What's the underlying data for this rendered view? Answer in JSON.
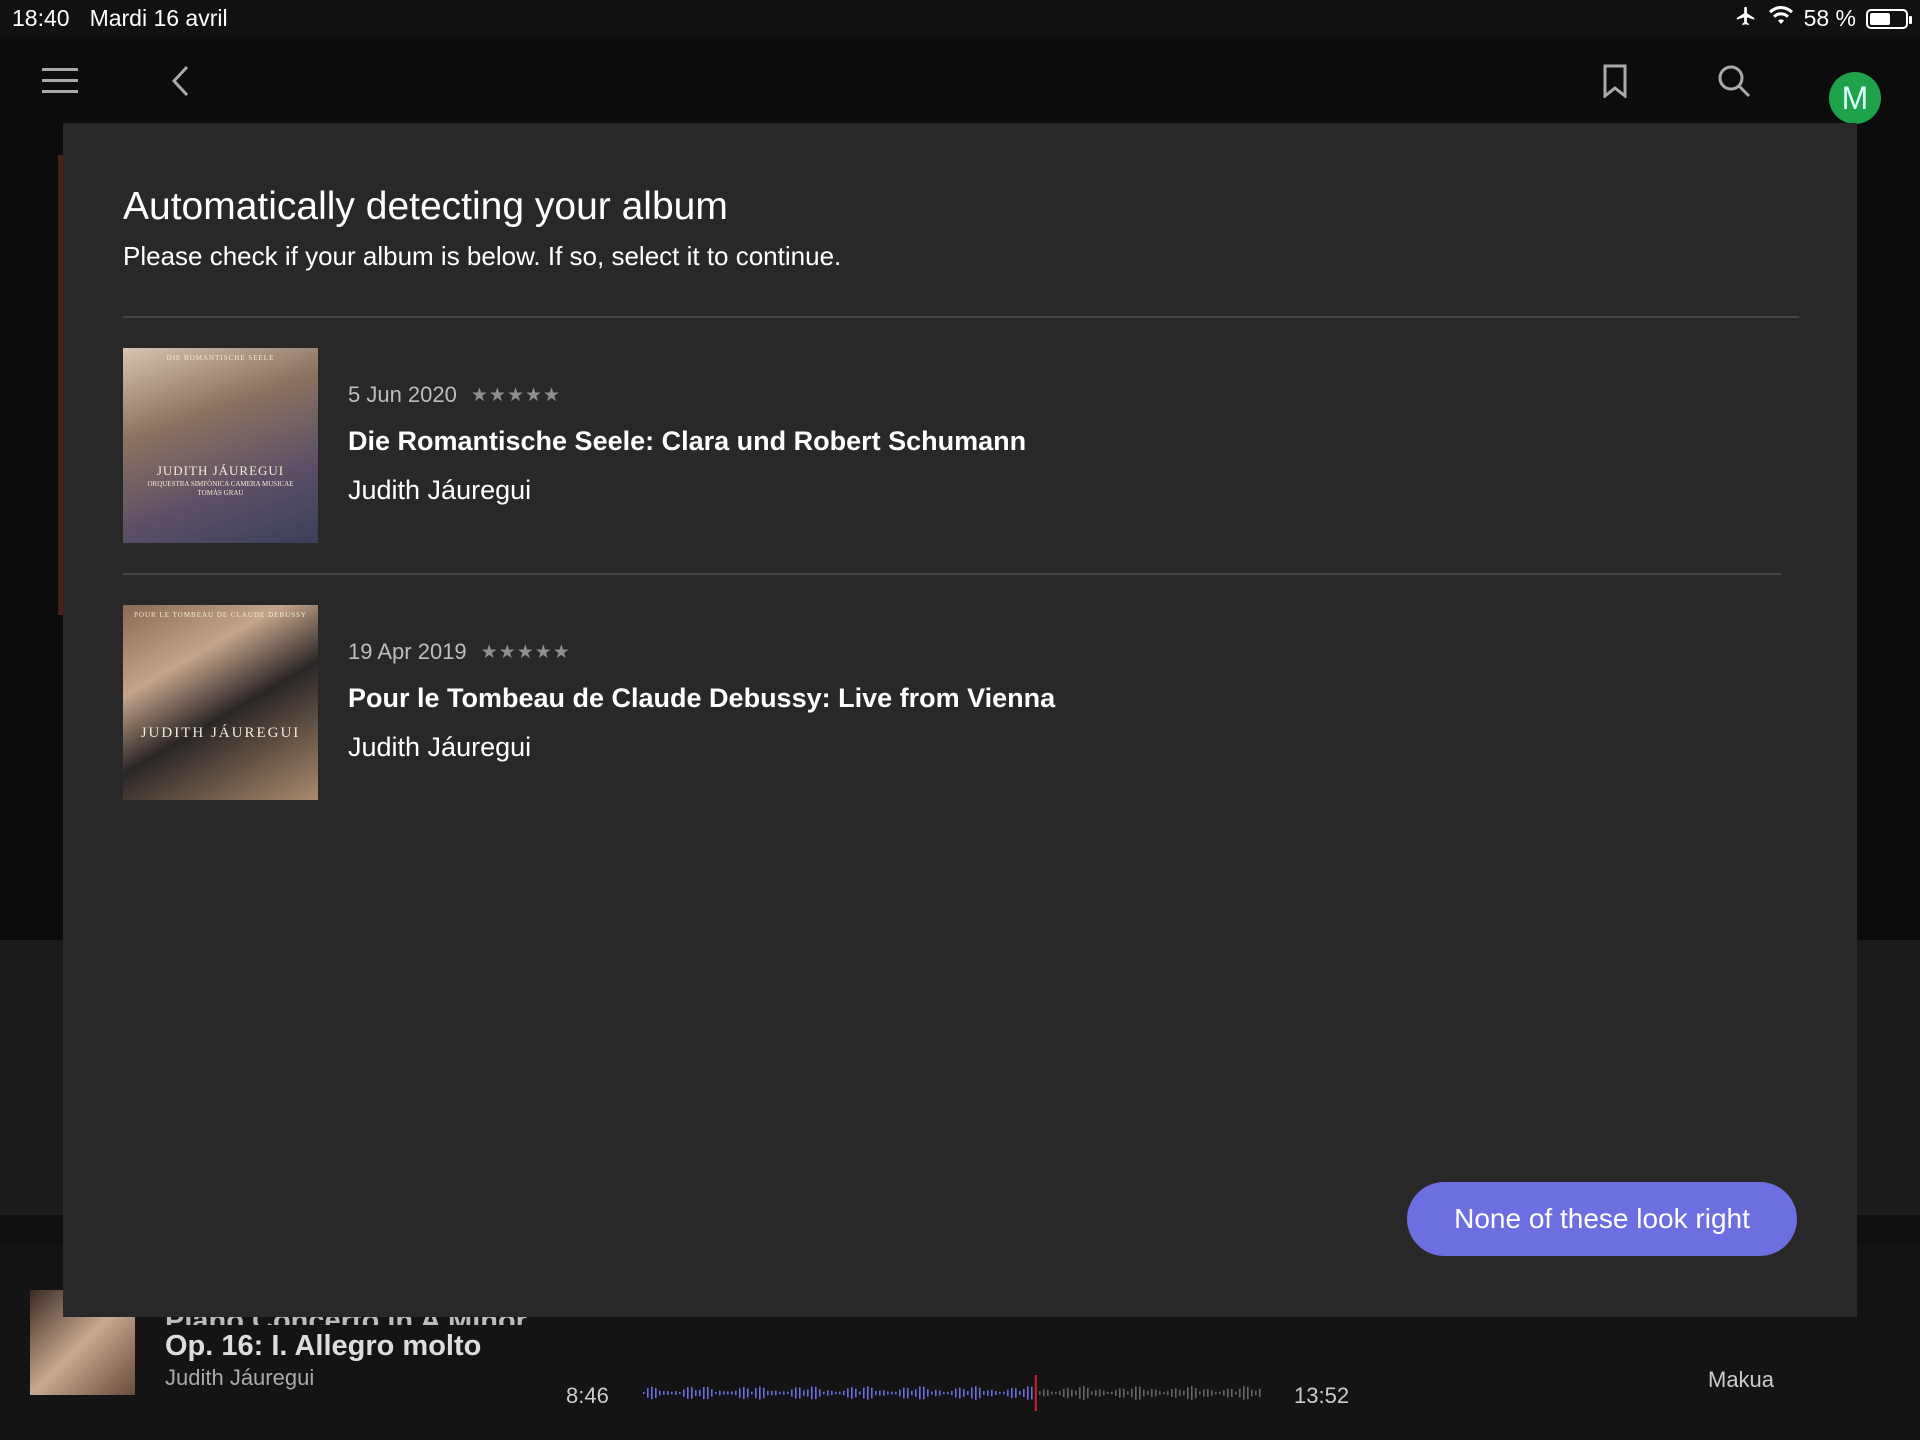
{
  "status_bar": {
    "time": "18:40",
    "date": "Mardi 16 avril",
    "battery": "58 %",
    "battery_level": 0.58
  },
  "nav": {
    "avatar_letter": "M",
    "avatar_color": "#1fa34a"
  },
  "modal": {
    "title": "Automatically detecting your album",
    "subtitle": "Please check if your album is below. If so, select it to continue.",
    "albums": [
      {
        "date": "5 Jun 2020",
        "stars": "★★★★★",
        "title": "Die Romantische Seele: Clara und Robert Schumann",
        "artist": "Judith Jáuregui",
        "art_lines": [
          "DIE ROMANTISCHE SEELE",
          "JUDITH JÁUREGUI",
          "ORQUESTRA SIMFÒNICA CAMERA MUSICAE",
          "TOMÀS GRAU"
        ]
      },
      {
        "date": "19 Apr 2019",
        "stars": "★★★★★",
        "title": "Pour le Tombeau de Claude Debussy: Live from Vienna",
        "artist": "Judith Jáuregui",
        "art_lines": [
          "POUR LE TOMBEAU DE CLAUDE DEBUSSY",
          "JUDITH JÁUREGUI"
        ]
      }
    ],
    "none_button": "None of these look right",
    "button_color": "#6c6fe0"
  },
  "player": {
    "title_top": "Piano Concerto in A Minor",
    "title": "Op. 16: I. Allegro molto",
    "artist": "Judith Jáuregui",
    "elapsed": "8:46",
    "total": "13:52",
    "progress": 0.632,
    "zone": "Makua"
  }
}
